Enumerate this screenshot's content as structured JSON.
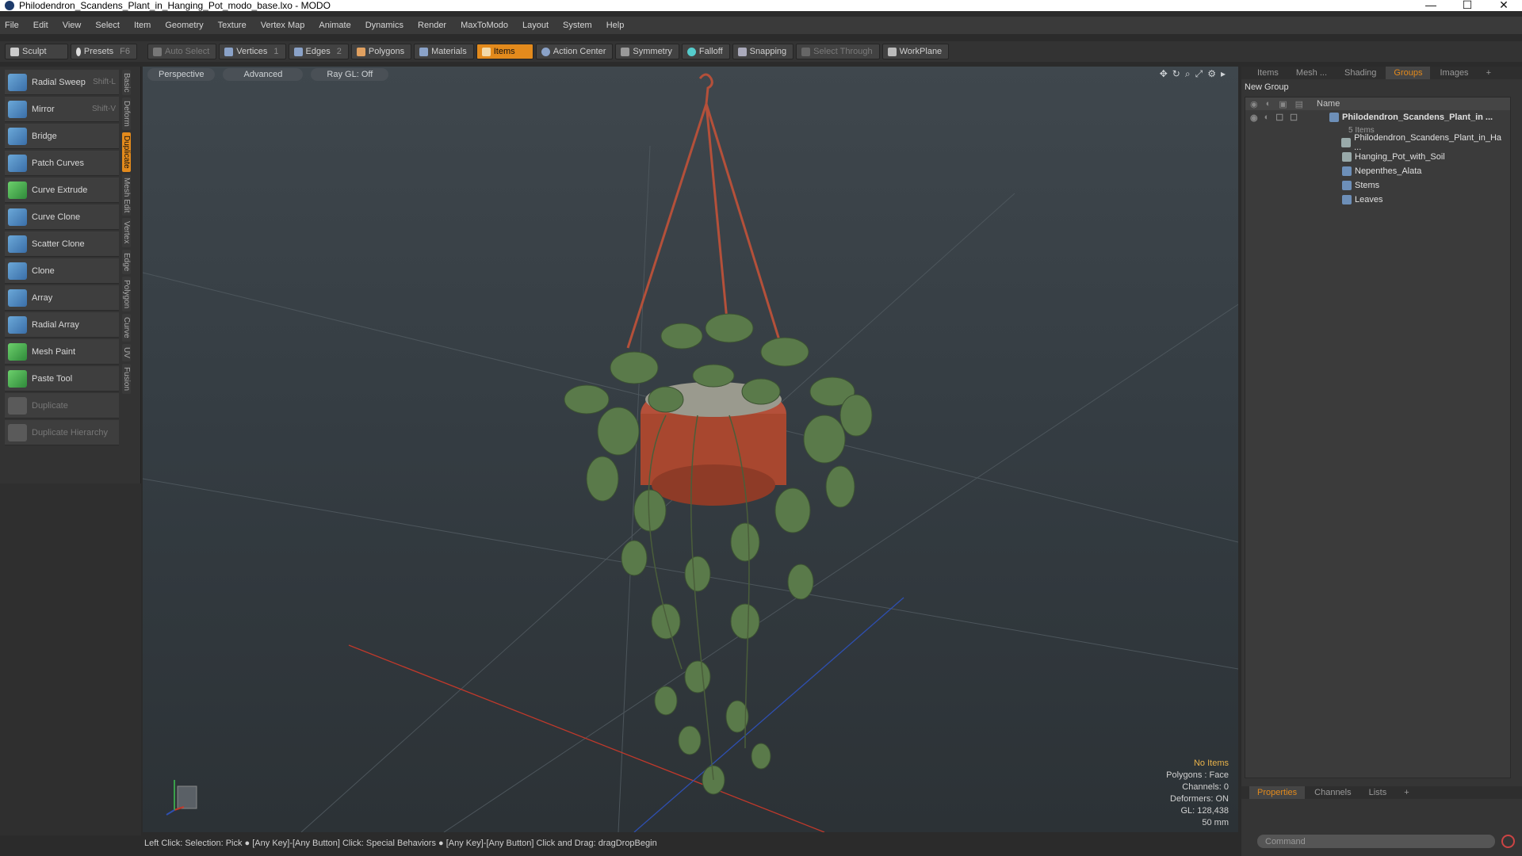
{
  "window": {
    "title": "Philodendron_Scandens_Plant_in_Hanging_Pot_modo_base.lxo - MODO",
    "controls": [
      "—",
      "☐",
      "✕"
    ]
  },
  "menu": [
    "File",
    "Edit",
    "View",
    "Select",
    "Item",
    "Geometry",
    "Texture",
    "Vertex Map",
    "Animate",
    "Dynamics",
    "Render",
    "MaxToModo",
    "Layout",
    "System",
    "Help"
  ],
  "toolbar": {
    "sculpt": "Sculpt",
    "presets": "Presets",
    "presets_key": "F6",
    "auto_select": "Auto Select",
    "vertices": "Vertices",
    "vertices_key": "1",
    "edges": "Edges",
    "edges_key": "2",
    "polygons": "Polygons",
    "materials": "Materials",
    "items": "Items",
    "action_center": "Action Center",
    "symmetry": "Symmetry",
    "falloff": "Falloff",
    "snapping": "Snapping",
    "select_through": "Select Through",
    "workplane": "WorkPlane"
  },
  "tools": [
    {
      "label": "Radial Sweep",
      "key": "Shift-L",
      "enabled": true
    },
    {
      "label": "Mirror",
      "key": "Shift-V",
      "enabled": true
    },
    {
      "label": "Bridge",
      "key": "",
      "enabled": true
    },
    {
      "label": "Patch Curves",
      "key": "",
      "enabled": true
    },
    {
      "label": "Curve Extrude",
      "key": "",
      "enabled": true
    },
    {
      "label": "Curve Clone",
      "key": "",
      "enabled": true
    },
    {
      "label": "Scatter Clone",
      "key": "",
      "enabled": true
    },
    {
      "label": "Clone",
      "key": "",
      "enabled": true
    },
    {
      "label": "Array",
      "key": "",
      "enabled": true
    },
    {
      "label": "Radial Array",
      "key": "",
      "enabled": true
    },
    {
      "label": "Mesh Paint",
      "key": "",
      "enabled": true
    },
    {
      "label": "Paste Tool",
      "key": "",
      "enabled": true
    },
    {
      "label": "Duplicate",
      "key": "",
      "enabled": false
    },
    {
      "label": "Duplicate Hierarchy",
      "key": "",
      "enabled": false
    }
  ],
  "vtabs": [
    "Basic",
    "Deform",
    "Duplicate",
    "Mesh Edit",
    "Vertex",
    "Edge",
    "Polygon",
    "Curve",
    "UV",
    "Fusion"
  ],
  "vtab_active": "Duplicate",
  "viewport": {
    "view": "Perspective",
    "mode": "Advanced",
    "raygl": "Ray GL: Off",
    "info": {
      "selection": "No Items",
      "polygons": "Polygons : Face",
      "channels": "Channels: 0",
      "deformers": "Deformers: ON",
      "gl": "GL: 128,438",
      "focal": "50 mm"
    }
  },
  "status": "Left Click: Selection: Pick ● [Any Key]-[Any Button] Click: Special Behaviors ● [Any Key]-[Any Button] Click and Drag: dragDropBegin",
  "right_panel": {
    "tabs": [
      "Items",
      "Mesh ...",
      "Shading",
      "Groups",
      "Images",
      "+"
    ],
    "active_tab": "Groups",
    "new_group": "New Group",
    "column_name": "Name",
    "group": {
      "name": "Philodendron_Scandens_Plant_in ...",
      "count": "5 Items"
    },
    "children": [
      "Philodendron_Scandens_Plant_in_Ha ...",
      "Hanging_Pot_with_Soil",
      "Nepenthes_Alata",
      "Stems",
      "Leaves"
    ],
    "bottom_tabs": [
      "Properties",
      "Channels",
      "Lists",
      "+"
    ],
    "bottom_active": "Properties",
    "command_placeholder": "Command"
  },
  "colors": {
    "accent": "#e38a1c",
    "pot": "#b4503a",
    "leaf": "#5a7a4a",
    "axis_x": "#c0392b",
    "axis_z": "#2e4fb0"
  }
}
